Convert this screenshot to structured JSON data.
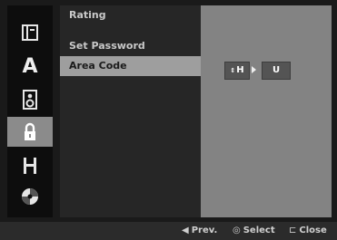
{
  "sidebar": {
    "items": [
      {
        "icon": "disc-menu-icon"
      },
      {
        "icon": "audio-icon",
        "glyph": "A"
      },
      {
        "icon": "speaker-icon"
      },
      {
        "icon": "lock-icon",
        "active": true
      },
      {
        "icon": "film-icon"
      },
      {
        "icon": "disc-icon"
      }
    ]
  },
  "menu": {
    "items": [
      {
        "label": "Rating"
      },
      {
        "label": "Set Password"
      },
      {
        "label": "Area Code",
        "selected": true
      }
    ]
  },
  "area_code": {
    "first_char": "H",
    "second_char": "U",
    "updown_glyph": "⇕",
    "arrow_glyph": "▶"
  },
  "footer": {
    "prev_symbol": "◀",
    "prev_label": "Prev.",
    "select_symbol": "◎",
    "select_label": "Select",
    "close_symbol": "⊏",
    "close_label": "Close"
  }
}
